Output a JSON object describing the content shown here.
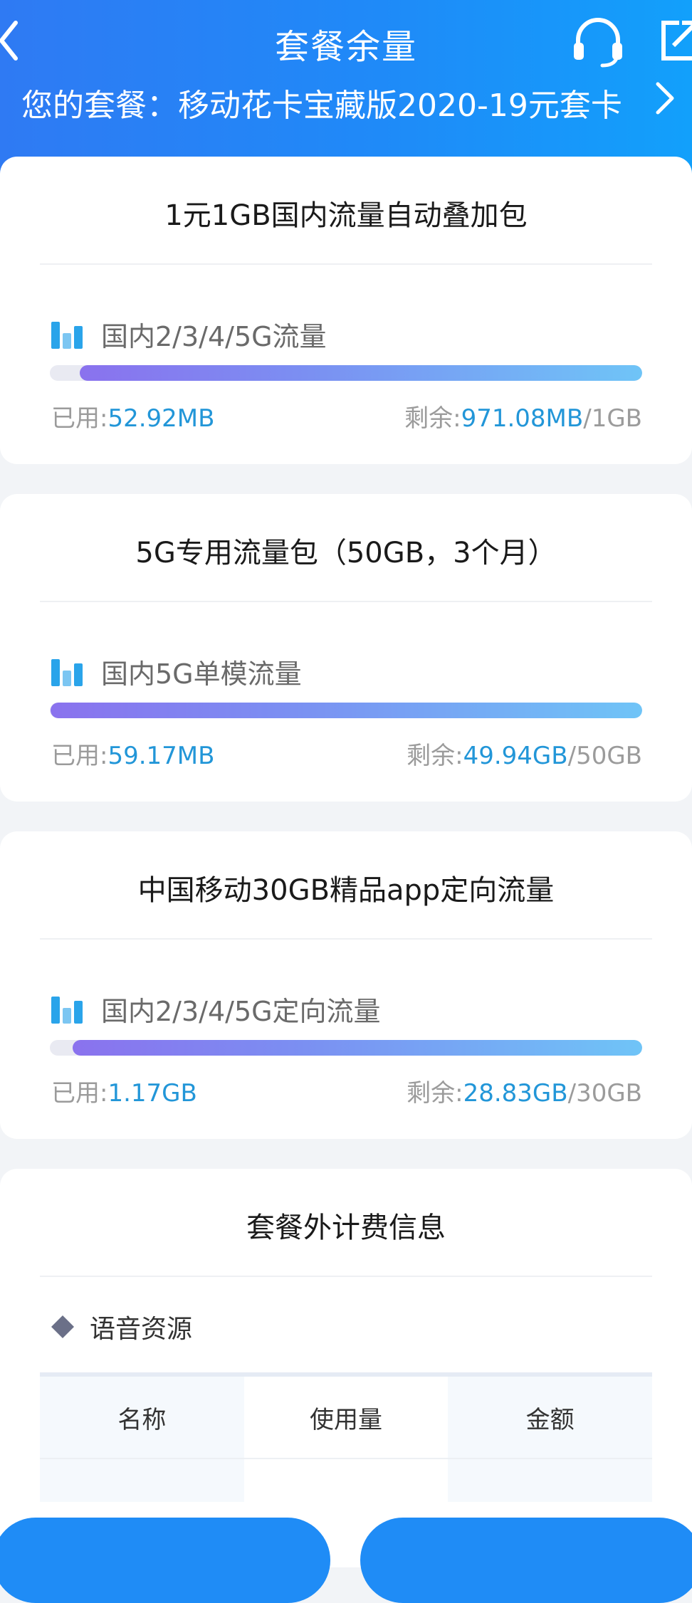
{
  "header": {
    "title": "套餐余量",
    "plan_text": "您的套餐：移动花卡宝藏版2020-19元套卡"
  },
  "icons": {
    "back": "chevron-left-icon",
    "service": "headset-icon",
    "share": "share-icon",
    "plan_more": "chevron-right-icon",
    "usage": "bar-chart-icon",
    "section": "diamond-icon"
  },
  "packages": [
    {
      "title": "1元1GB国内流量自动叠加包",
      "resource": "国内2/3/4/5G流量",
      "used_label": "已用:",
      "used": "52.92MB",
      "remain_label": "剩余:",
      "remain": "971.08MB",
      "total": "/1GB",
      "remaining_fraction": 0.95
    },
    {
      "title": "5G专用流量包（50GB，3个月）",
      "resource": "国内5G单模流量",
      "used_label": "已用:",
      "used": "59.17MB",
      "remain_label": "剩余:",
      "remain": "49.94GB",
      "total": "/50GB",
      "remaining_fraction": 0.9988
    },
    {
      "title": "中国移动30GB精品app定向流量",
      "resource": "国内2/3/4/5G定向流量",
      "used_label": "已用:",
      "used": "1.17GB",
      "remain_label": "剩余:",
      "remain": "28.83GB",
      "total": "/30GB",
      "remaining_fraction": 0.961
    }
  ],
  "billing": {
    "title": "套餐外计费信息",
    "section": "语音资源",
    "columns": [
      "名称",
      "使用量",
      "金额"
    ]
  },
  "colors": {
    "header_start": "#2f7af3",
    "header_end": "#12a0fb",
    "accent_text": "#2296d8",
    "bar_start": "#8a72ee",
    "bar_end": "#6fc4f7"
  }
}
